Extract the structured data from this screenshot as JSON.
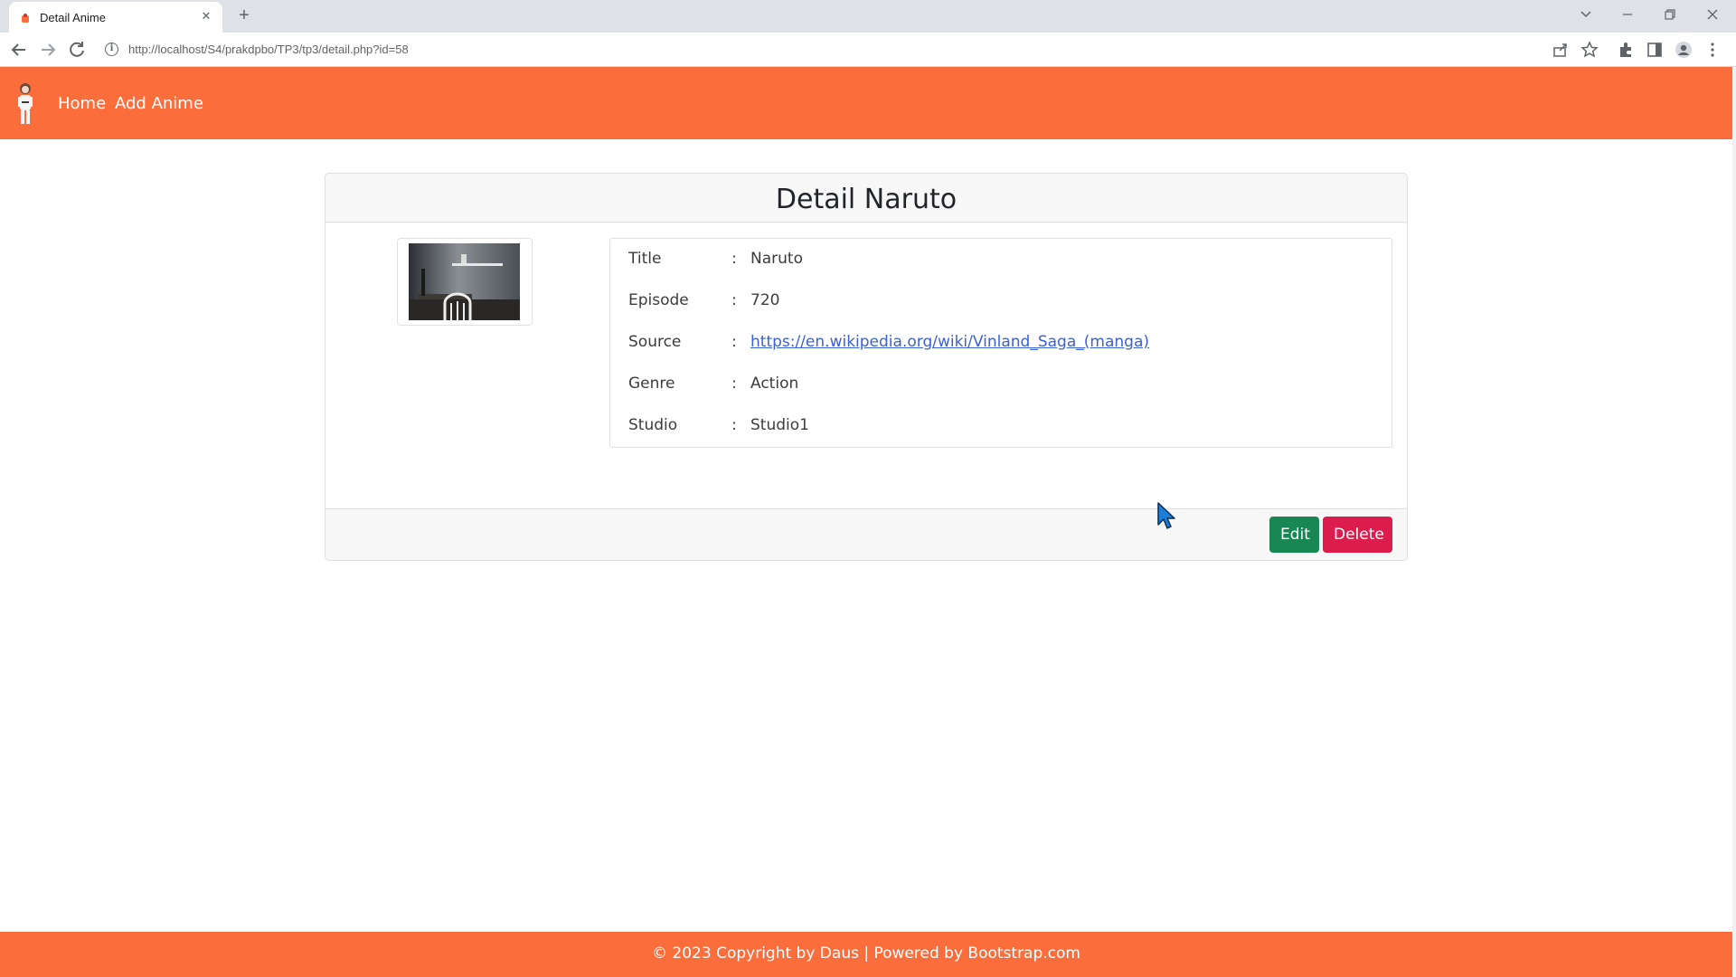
{
  "browser": {
    "tab_title": "Detail Anime",
    "tab_close": "✕",
    "new_tab": "+",
    "url": "http://localhost/S4/prakdpbo/TP3/tp3/detail.php?id=58",
    "info_icon": "i"
  },
  "navbar": {
    "links": [
      {
        "label": "Home"
      },
      {
        "label": "Add Anime"
      }
    ]
  },
  "card": {
    "title": "Detail Naruto",
    "rows": [
      {
        "label": "Title",
        "colon": ":",
        "value": "Naruto"
      },
      {
        "label": "Episode",
        "colon": ":",
        "value": "720"
      },
      {
        "label": "Source",
        "colon": ":",
        "value": "https://en.wikipedia.org/wiki/Vinland_Saga_(manga)"
      },
      {
        "label": "Genre",
        "colon": ":",
        "value": "Action"
      },
      {
        "label": "Studio",
        "colon": ":",
        "value": "Studio1"
      }
    ],
    "buttons": {
      "edit": "Edit",
      "delete": "Delete"
    }
  },
  "footer": {
    "text": "© 2023 Copyright by Daus  |  Powered by Bootstrap.com"
  },
  "colors": {
    "brand": "#fb6e3c",
    "edit": "#198754",
    "delete": "#dc1c4c",
    "link": "#3b5fd6"
  }
}
